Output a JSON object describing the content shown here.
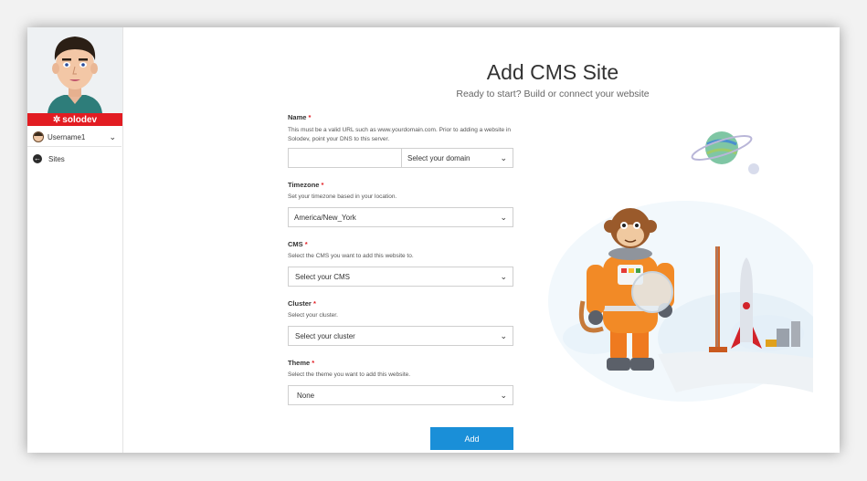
{
  "sidebar": {
    "brand": "solodev",
    "username": "Username1",
    "nav": [
      {
        "label": "Sites"
      }
    ]
  },
  "header": {
    "title": "Add CMS Site",
    "subtitle": "Ready to start? Build or connect your website"
  },
  "form": {
    "name": {
      "label": "Name",
      "required_mark": "*",
      "help": "This must be a valid URL such as www.yourdomain.com. Prior to adding a website in Solodev, point your DNS to this server.",
      "value": "",
      "domain_placeholder": "Select your domain"
    },
    "timezone": {
      "label": "Timezone",
      "required_mark": "*",
      "help": "Set your timezone based in your location.",
      "value": "America/New_York"
    },
    "cms": {
      "label": "CMS",
      "required_mark": "*",
      "help": "Select the CMS you want to add this website to.",
      "value": "Select your CMS"
    },
    "cluster": {
      "label": "Cluster",
      "required_mark": "*",
      "help": "Select your cluster.",
      "value": "Select your cluster"
    },
    "theme": {
      "label": "Theme",
      "required_mark": "*",
      "help": "Select the theme you want to add this website.",
      "value": "None"
    },
    "submit_label": "Add"
  },
  "colors": {
    "brand_red": "#e21c22",
    "button_blue": "#1a8fd8"
  },
  "icons": {
    "chevron": "chevron-down-icon",
    "back": "arrow-left-circle-icon",
    "brand_mark": "solodev-logo-icon"
  }
}
